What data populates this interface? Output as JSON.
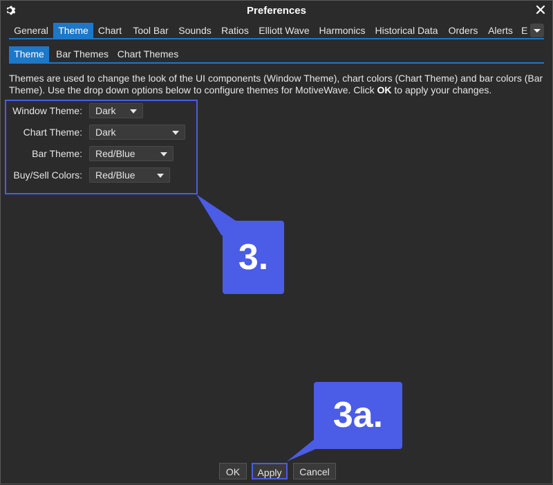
{
  "window": {
    "title": "Preferences"
  },
  "tabs": [
    {
      "label": "General"
    },
    {
      "label": "Theme"
    },
    {
      "label": "Chart"
    },
    {
      "label": "Tool Bar"
    },
    {
      "label": "Sounds"
    },
    {
      "label": "Ratios"
    },
    {
      "label": "Elliott Wave"
    },
    {
      "label": "Harmonics"
    },
    {
      "label": "Historical Data"
    },
    {
      "label": "Orders"
    },
    {
      "label": "Alerts"
    },
    {
      "label": "E"
    }
  ],
  "subtabs": [
    {
      "label": "Theme"
    },
    {
      "label": "Bar Themes"
    },
    {
      "label": "Chart Themes"
    }
  ],
  "description": {
    "part1": "Themes are used to change the look of the UI components (Window Theme), chart colors (Chart Theme) and bar colors (Bar Theme).  Use the drop down options below to configure themes for MotiveWave.  Click ",
    "bold": "OK",
    "part2": " to apply your changes."
  },
  "fields": {
    "window_theme": {
      "label": "Window Theme:",
      "value": "Dark"
    },
    "chart_theme": {
      "label": "Chart Theme:",
      "value": "Dark"
    },
    "bar_theme": {
      "label": "Bar Theme:",
      "value": "Red/Blue"
    },
    "buy_sell_colors": {
      "label": "Buy/Sell Colors:",
      "value": "Red/Blue"
    }
  },
  "annotations": {
    "step3": "3.",
    "step3a": "3a."
  },
  "buttons": {
    "ok": "OK",
    "apply": "Apply",
    "cancel": "Cancel"
  },
  "colors": {
    "accent": "#1e78c8",
    "annotation": "#4b5ce6",
    "background": "#2b2b2b"
  }
}
